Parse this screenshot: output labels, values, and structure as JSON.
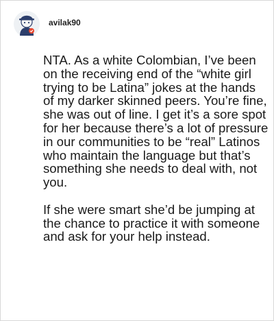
{
  "post": {
    "username": "avilak90",
    "paragraphs": [
      "NTA. As a white Colombian, I’ve been on the receiving end of the “white girl trying to be Latina” jokes at the hands of my darker skinned peers. You’re fine, she was out of line. I get it’s a sore spot for her because there’s a lot of pressure in our communities to be “real” Latinos who maintain the language but that’s something she needs to deal with, not you.",
      "If she were smart she’d be jumping at the chance to practice it with someone and ask for your help instead."
    ]
  },
  "avatar": {
    "icon": "user-avatar-icon",
    "colors": {
      "background": "#eef1f4",
      "body": "#2c3e6b",
      "accent": "#e8472f",
      "skin": "#f6f6f6"
    }
  }
}
